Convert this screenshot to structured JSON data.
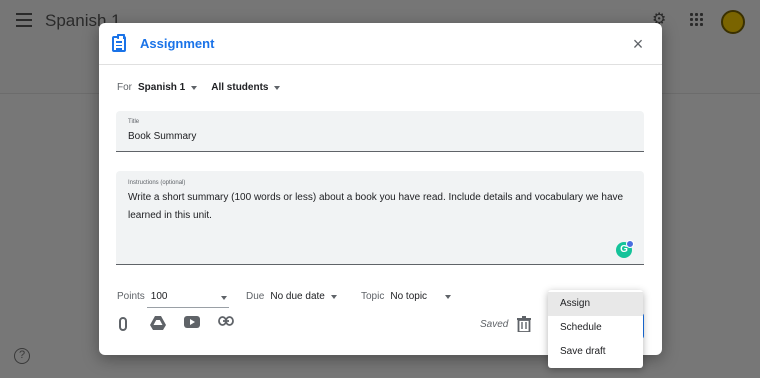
{
  "app": {
    "class_name": "Spanish 1"
  },
  "dialog": {
    "title": "Assignment",
    "for_label": "For",
    "class_select": "Spanish 1",
    "students_select": "All students",
    "title_field": {
      "label": "Title",
      "value": "Book Summary"
    },
    "instructions_field": {
      "label": "Instructions (optional)",
      "value": "Write a short summary (100 words or less) about a book you have read. Include details and vocabulary we have learned in this unit."
    },
    "points": {
      "label": "Points",
      "value": "100"
    },
    "due": {
      "label": "Due",
      "value": "No due date"
    },
    "topic": {
      "label": "Topic",
      "value": "No topic"
    },
    "saved_status": "Saved",
    "grammarly_letter": "G"
  },
  "assign_menu": {
    "items": [
      "Assign",
      "Schedule",
      "Save draft"
    ],
    "highlighted": "Assign"
  },
  "icons": {
    "help": "?",
    "close": "×",
    "gear": "⚙"
  },
  "colors": {
    "accent": "#1a73e8",
    "grammarly": "#15c39a"
  }
}
